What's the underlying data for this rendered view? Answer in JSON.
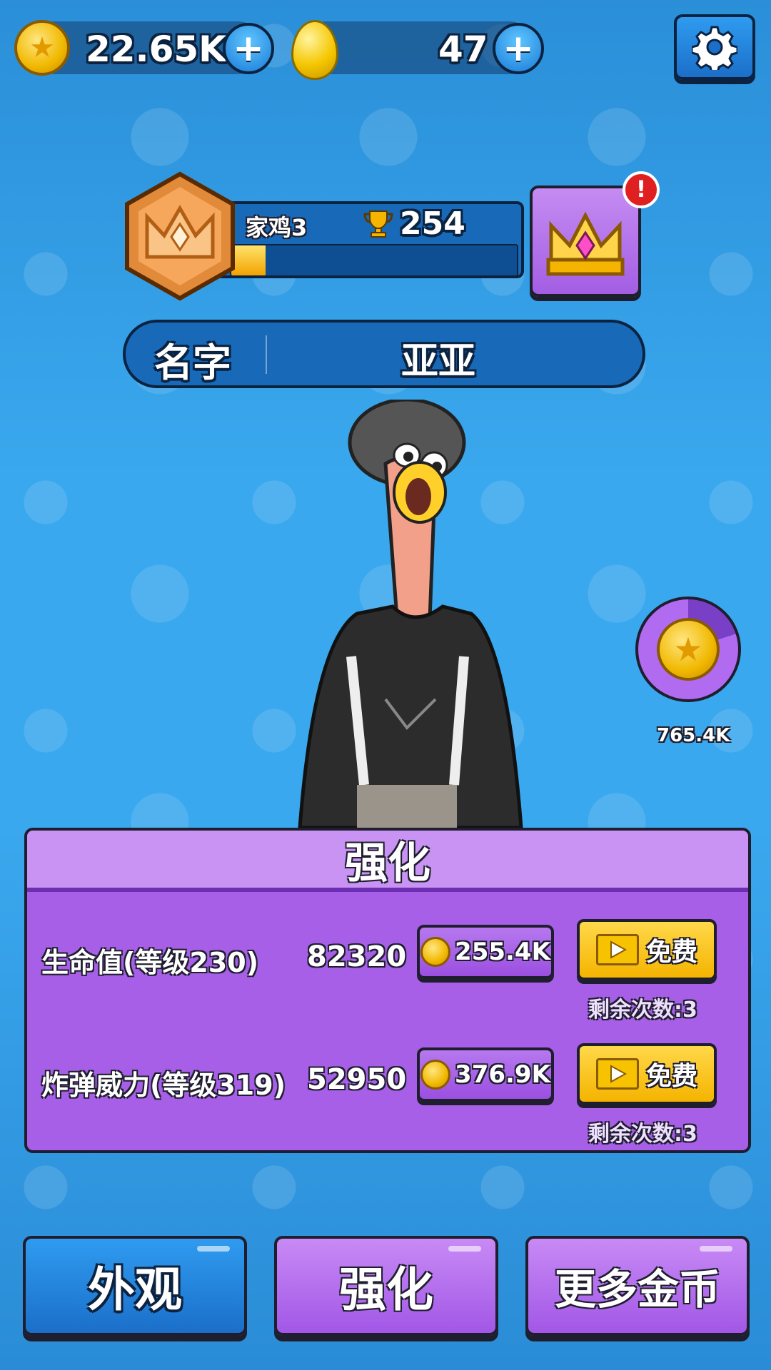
{
  "resources": {
    "coins": "22.65K",
    "eggs": "47"
  },
  "rank": {
    "title": "家鸡3",
    "trophies": "254",
    "progress": 0.12
  },
  "name_field": {
    "label": "名字",
    "value": "亚亚"
  },
  "side_reward": {
    "amount": "765.4K"
  },
  "upgrade_panel": {
    "title": "强化",
    "rows": [
      {
        "label": "生命值(等级230)",
        "value": "82320",
        "cost": "255.4K",
        "free_label": "免费",
        "remaining": "剩余次数:3"
      },
      {
        "label": "炸弹威力(等级319)",
        "value": "52950",
        "cost": "376.9K",
        "free_label": "免费",
        "remaining": "剩余次数:3"
      }
    ]
  },
  "tabs": {
    "appearance": "外观",
    "upgrade": "强化",
    "more_coins": "更多金币"
  },
  "icons": [
    "star-coin-icon",
    "plus-icon",
    "egg-icon",
    "gear-icon",
    "crown-icon",
    "trophy-icon",
    "alert-icon",
    "video-play-icon"
  ],
  "colors": {
    "background": "#3aa8ee",
    "panel_purple": "#a65fe6",
    "button_blue": "#1b6fc9",
    "button_yellow": "#f5b400"
  }
}
